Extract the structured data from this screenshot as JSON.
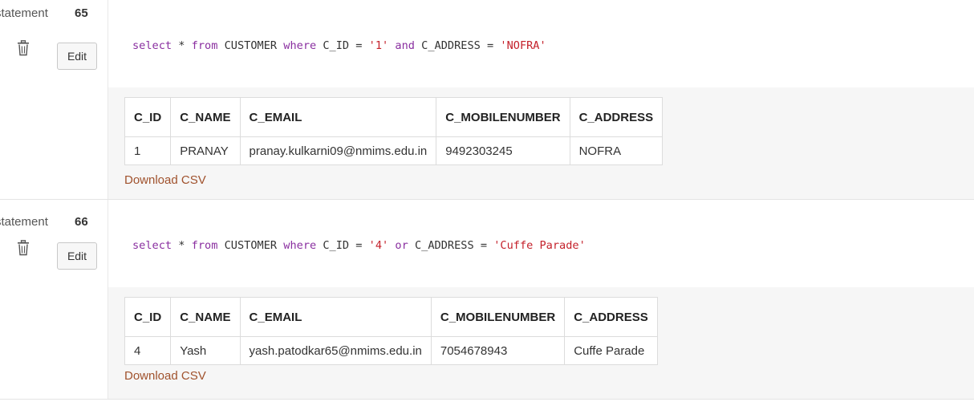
{
  "statements": [
    {
      "label": "statement",
      "number": "65",
      "edit_label": "Edit",
      "sql": [
        {
          "t": "select",
          "c": "kw"
        },
        {
          "t": " * ",
          "c": ""
        },
        {
          "t": "from",
          "c": "kw"
        },
        {
          "t": " CUSTOMER ",
          "c": ""
        },
        {
          "t": "where",
          "c": "kw"
        },
        {
          "t": " C_ID = ",
          "c": ""
        },
        {
          "t": "'1'",
          "c": "str"
        },
        {
          "t": " ",
          "c": ""
        },
        {
          "t": "and",
          "c": "kw"
        },
        {
          "t": " C_ADDRESS = ",
          "c": ""
        },
        {
          "t": "'NOFRA'",
          "c": "str"
        }
      ],
      "columns": [
        "C_ID",
        "C_NAME",
        "C_EMAIL",
        "C_MOBILENUMBER",
        "C_ADDRESS"
      ],
      "rows": [
        [
          "1",
          "PRANAY",
          "pranay.kulkarni09@nmims.edu.in",
          "9492303245",
          "NOFRA"
        ]
      ],
      "download_label": "Download CSV"
    },
    {
      "label": "statement",
      "number": "66",
      "edit_label": "Edit",
      "sql": [
        {
          "t": "select",
          "c": "kw"
        },
        {
          "t": " * ",
          "c": ""
        },
        {
          "t": "from",
          "c": "kw"
        },
        {
          "t": " CUSTOMER ",
          "c": ""
        },
        {
          "t": "where",
          "c": "kw"
        },
        {
          "t": " C_ID = ",
          "c": ""
        },
        {
          "t": "'4'",
          "c": "str"
        },
        {
          "t": " ",
          "c": ""
        },
        {
          "t": "or",
          "c": "kw"
        },
        {
          "t": " C_ADDRESS = ",
          "c": ""
        },
        {
          "t": "'Cuffe Parade'",
          "c": "str"
        }
      ],
      "columns": [
        "C_ID",
        "C_NAME",
        "C_EMAIL",
        "C_MOBILENUMBER",
        "C_ADDRESS"
      ],
      "rows": [
        [
          "4",
          "Yash",
          "yash.patodkar65@nmims.edu.in",
          "7054678943",
          "Cuffe Parade"
        ]
      ],
      "download_label": "Download CSV"
    }
  ],
  "icons": {
    "delete": "trash-icon"
  },
  "colors": {
    "keyword": "#8a2fa0",
    "string": "#c4212b",
    "link": "#a0522d"
  }
}
